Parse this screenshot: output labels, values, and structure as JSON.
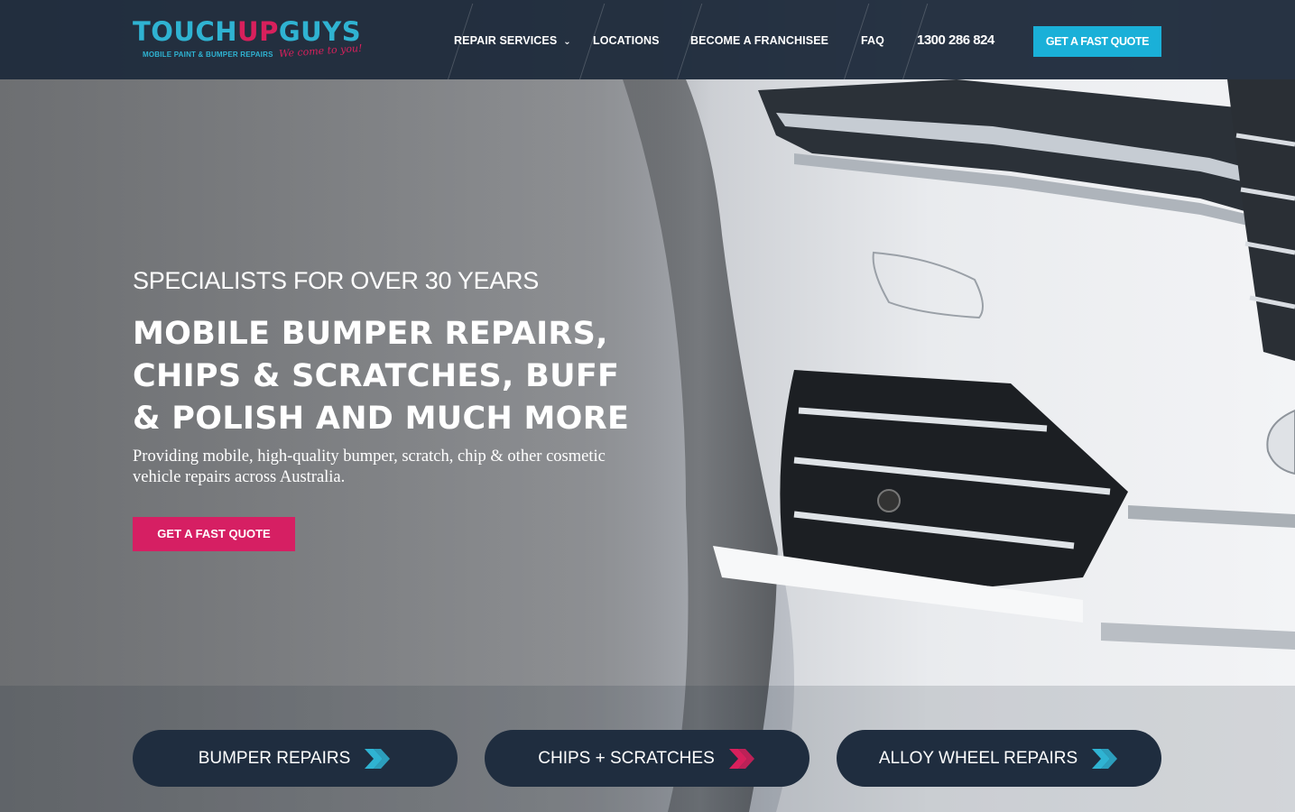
{
  "brand": {
    "logo_part1": "TOUCH",
    "logo_part2": "UP",
    "logo_part3": "GUYS",
    "subtitle": "MOBILE PAINT & BUMPER REPAIRS",
    "tagline": "We come to you!",
    "colors": {
      "primary_blue": "#2fb3d2",
      "accent_pink": "#d8205c",
      "navy": "#1f2c3c"
    }
  },
  "nav": {
    "items": [
      {
        "label": "REPAIR SERVICES",
        "has_dropdown": true,
        "icon": "chevron-down-icon"
      },
      {
        "label": "LOCATIONS"
      },
      {
        "label": "BECOME A FRANCHISEE"
      },
      {
        "label": "FAQ"
      }
    ],
    "phone": "1300 286 824",
    "quote_button": "GET A FAST QUOTE"
  },
  "hero": {
    "eyebrow": "SPECIALISTS FOR OVER 30 YEARS",
    "headline_line1": "MOBILE BUMPER REPAIRS,",
    "headline_line2": "CHIPS & SCRATCHES, BUFF",
    "headline_line3": "& POLISH AND MUCH MORE",
    "description": "Providing mobile, high-quality bumper, scratch, chip & other cosmetic vehicle repairs across Australia.",
    "cta_label": "GET A FAST QUOTE"
  },
  "services": [
    {
      "label": "BUMPER REPAIRS",
      "icon": "double-chevron-right-icon",
      "icon_color": "#2fb3d2"
    },
    {
      "label": "CHIPS + SCRATCHES",
      "icon": "double-chevron-right-icon",
      "icon_color": "#d8205c"
    },
    {
      "label": "ALLOY WHEEL REPAIRS",
      "icon": "double-chevron-right-icon",
      "icon_color": "#2fb3d2"
    }
  ]
}
